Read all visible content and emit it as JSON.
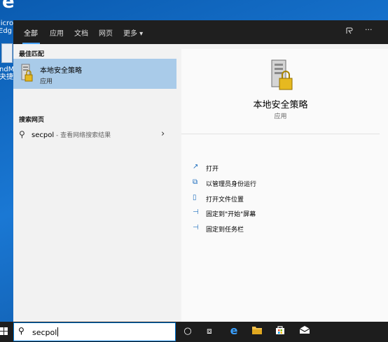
{
  "desktop": {
    "edge_label": "licro\nEdg",
    "icon2_label": "ndM\n夬捷\n"
  },
  "topbar": {
    "tabs": [
      {
        "label": "全部",
        "active": true
      },
      {
        "label": "应用",
        "active": false
      },
      {
        "label": "文档",
        "active": false
      },
      {
        "label": "网页",
        "active": false
      },
      {
        "label": "更多 ▾",
        "active": false
      }
    ],
    "feedback_icon": "feedback-icon",
    "more_icon": "more-options-icon"
  },
  "results": {
    "best_match_header": "最佳匹配",
    "best_match": {
      "name": "本地安全策略",
      "type": "应用"
    },
    "web_header": "搜索网页",
    "web_query": "secpol",
    "web_hint": " - 查看网络搜索结果"
  },
  "detail": {
    "title": "本地安全策略",
    "type": "应用",
    "actions": [
      {
        "icon": "open-icon",
        "label": "打开"
      },
      {
        "icon": "admin-run-icon",
        "label": "以管理员身份运行"
      },
      {
        "icon": "folder-location-icon",
        "label": "打开文件位置"
      },
      {
        "icon": "pin-start-icon",
        "label": "固定到\"开始\"屏幕"
      },
      {
        "icon": "pin-taskbar-icon",
        "label": "固定到任务栏"
      }
    ]
  },
  "taskbar": {
    "search_value": "secpol",
    "icons": [
      "cortana-icon",
      "task-view-icon",
      "edge-icon",
      "file-explorer-icon",
      "store-icon",
      "mail-icon"
    ]
  },
  "colors": {
    "accent": "#0078d7",
    "selected": "#a9cbe9",
    "topbar": "#1f1f1f",
    "taskbar": "#1d1d1d"
  }
}
